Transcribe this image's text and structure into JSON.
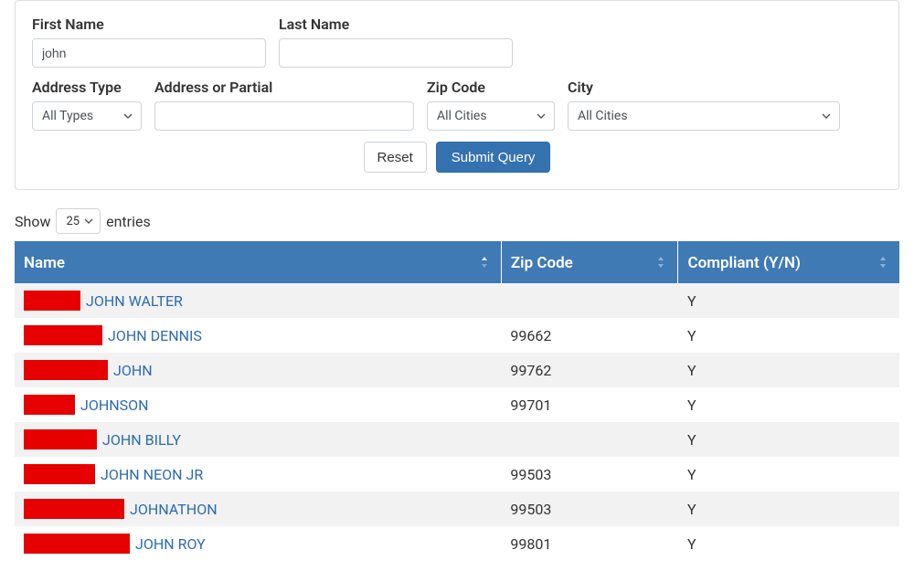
{
  "search": {
    "firstName": {
      "label": "First Name",
      "value": "john"
    },
    "lastName": {
      "label": "Last Name",
      "value": ""
    },
    "addressType": {
      "label": "Address Type",
      "selected": "All Types"
    },
    "address": {
      "label": "Address or Partial",
      "value": ""
    },
    "zip": {
      "label": "Zip Code",
      "selected": "All Cities"
    },
    "city": {
      "label": "City",
      "selected": "All Cities"
    },
    "resetLabel": "Reset",
    "submitLabel": "Submit Query"
  },
  "table": {
    "showPrefix": "Show",
    "showSuffix": "entries",
    "pageSize": "25",
    "columns": {
      "name": "Name",
      "zip": "Zip Code",
      "compliant": "Compliant (Y/N)"
    },
    "rows": [
      {
        "redactW": 62,
        "name": "JOHN WALTER",
        "zip": "",
        "compliant": "Y"
      },
      {
        "redactW": 86,
        "name": "JOHN DENNIS",
        "zip": "99662",
        "compliant": "Y"
      },
      {
        "redactW": 92,
        "name": "JOHN",
        "zip": "99762",
        "compliant": "Y"
      },
      {
        "redactW": 56,
        "name": "JOHNSON",
        "zip": "99701",
        "compliant": "Y"
      },
      {
        "redactW": 80,
        "name": "JOHN BILLY",
        "zip": "",
        "compliant": "Y"
      },
      {
        "redactW": 78,
        "name": "JOHN NEON JR",
        "zip": "99503",
        "compliant": "Y"
      },
      {
        "redactW": 110,
        "name": "JOHNATHON",
        "zip": "99503",
        "compliant": "Y"
      },
      {
        "redactW": 116,
        "name": "JOHN ROY",
        "zip": "99801",
        "compliant": "Y"
      }
    ]
  }
}
